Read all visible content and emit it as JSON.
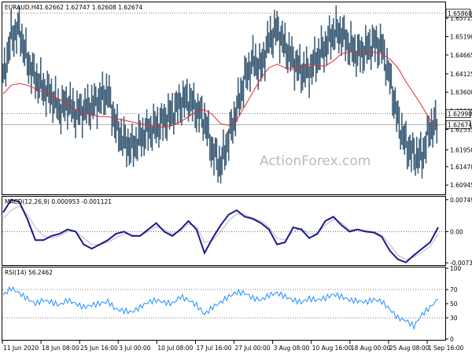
{
  "chart_data": {
    "type": "line",
    "symbol": "EURAUD,H4",
    "ohlc_label": "1.62662 1.62747 1.62608 1.62674",
    "watermark": "ActionForex.com",
    "x_labels": [
      "11 Jun 2020",
      "18 Jun 08:00",
      "25 Jun 16:00",
      "3 Jul 00:00",
      "10 Jul 08:00",
      "17 Jul 16:00",
      "27 Jul 00:00",
      "3 Aug 08:00",
      "10 Aug 16:00",
      "18 Aug 00:00",
      "25 Aug 08:00",
      "1 Sep 16:00"
    ],
    "price_panel": {
      "ylim": [
        1.6068,
        1.6617
      ],
      "ticks": [
        "1.65715",
        "1.65190",
        "1.64665",
        "1.64125",
        "1.63600",
        "1.63065",
        "1.62535",
        "1.61950",
        "1.61470",
        "1.60945"
      ],
      "tick_values": [
        1.65715,
        1.6519,
        1.64665,
        1.64125,
        1.636,
        1.63065,
        1.62535,
        1.6195,
        1.6147,
        1.60945
      ],
      "resistance_label": "1.65860",
      "resistance": 1.6586,
      "support_label": "1.62990",
      "support": 1.6299,
      "current_label": "1.62674",
      "current": 1.62674,
      "ma_color": "#e8282b",
      "bar_color": "#3f5f78",
      "ma": [
        1.6355,
        1.638,
        1.6385,
        1.638,
        1.637,
        1.636,
        1.635,
        1.634,
        1.6325,
        1.631,
        1.63,
        1.6295,
        1.629,
        1.629,
        1.6285,
        1.628,
        1.6275,
        1.627,
        1.6265,
        1.6262,
        1.626,
        1.6265,
        1.6275,
        1.629,
        1.6305,
        1.631,
        1.6295,
        1.627,
        1.6265,
        1.628,
        1.632,
        1.636,
        1.64,
        1.643,
        1.644,
        1.643,
        1.6425,
        1.643,
        1.644,
        1.6435,
        1.6435,
        1.645,
        1.647,
        1.6475,
        1.6475,
        1.6475,
        1.6475,
        1.647,
        1.6455,
        1.643,
        1.639,
        1.6355,
        1.632,
        1.628,
        1.6265
      ],
      "close": [
        1.64,
        1.652,
        1.654,
        1.645,
        1.64,
        1.637,
        1.635,
        1.631,
        1.633,
        1.63,
        1.631,
        1.632,
        1.634,
        1.636,
        1.626,
        1.622,
        1.62,
        1.623,
        1.625,
        1.626,
        1.628,
        1.63,
        1.633,
        1.634,
        1.631,
        1.628,
        1.619,
        1.615,
        1.623,
        1.631,
        1.64,
        1.645,
        1.643,
        1.651,
        1.654,
        1.649,
        1.645,
        1.642,
        1.642,
        1.646,
        1.649,
        1.653,
        1.653,
        1.649,
        1.647,
        1.648,
        1.65,
        1.649,
        1.64,
        1.628,
        1.621,
        1.618,
        1.6175,
        1.626,
        1.627
      ]
    },
    "macd_panel": {
      "label": "MACD(12,26,9) 0.000953 -0.001121",
      "ylim": [
        -0.00785,
        0.0082
      ],
      "tick_labels": [
        "0.007497",
        "0.00",
        "-0.007306"
      ],
      "tick_values": [
        0.007497,
        0.0,
        -0.007306
      ],
      "line_color": "#1a1a8c",
      "signal_color": "#b8b8b8",
      "macd": [
        0.0045,
        0.0075,
        0.007,
        0.003,
        -0.002,
        -0.002,
        -0.001,
        -0.0005,
        0.0005,
        0.0,
        -0.003,
        -0.004,
        -0.003,
        -0.002,
        -0.0005,
        0.0,
        -0.001,
        -0.001,
        0.0005,
        0.002,
        0.0,
        -0.001,
        0.0005,
        0.0025,
        0.0005,
        -0.005,
        -0.0015,
        0.0015,
        0.004,
        0.005,
        0.0035,
        0.003,
        0.002,
        0.0005,
        -0.003,
        -0.0025,
        0.001,
        0.0005,
        -0.0015,
        -0.0005,
        0.0025,
        0.0035,
        0.0015,
        0.0,
        0.0005,
        0.0,
        -0.0002,
        -0.0012,
        -0.0045,
        -0.0065,
        -0.0072,
        -0.0055,
        -0.004,
        -0.0025,
        0.001
      ],
      "signal": [
        0.003,
        0.005,
        0.006,
        0.004,
        0.001,
        -0.001,
        -0.0015,
        -0.001,
        0.0,
        0.0,
        -0.0015,
        -0.003,
        -0.003,
        -0.0025,
        -0.0015,
        -0.0005,
        -0.0008,
        -0.001,
        0.0,
        0.0012,
        0.0005,
        -0.0005,
        0.0,
        0.0018,
        0.0012,
        -0.0025,
        -0.002,
        0.0,
        0.0025,
        0.0042,
        0.004,
        0.0032,
        0.0025,
        0.001,
        -0.0015,
        -0.002,
        0.0,
        0.0008,
        -0.0005,
        -0.0005,
        0.0015,
        0.003,
        0.002,
        0.0005,
        0.0005,
        0.0002,
        0.0,
        -0.0008,
        -0.003,
        -0.0055,
        -0.0065,
        -0.006,
        -0.0048,
        -0.0035,
        -0.0005
      ]
    },
    "rsi_panel": {
      "label": "RSI(14) 56.2462",
      "ylim": [
        0,
        100
      ],
      "tick_labels": [
        "100",
        "70",
        "50",
        "30",
        "0"
      ],
      "tick_values": [
        100,
        70,
        50,
        30,
        0
      ],
      "color": "#1e90ff",
      "values": [
        62,
        72,
        65,
        57,
        50,
        55,
        52,
        48,
        55,
        50,
        45,
        48,
        50,
        53,
        42,
        40,
        38,
        45,
        52,
        55,
        52,
        50,
        60,
        55,
        48,
        35,
        45,
        52,
        60,
        66,
        65,
        58,
        55,
        62,
        65,
        60,
        55,
        52,
        57,
        55,
        58,
        63,
        60,
        55,
        54,
        52,
        56,
        53,
        42,
        30,
        26,
        18,
        35,
        45,
        56
      ]
    }
  }
}
